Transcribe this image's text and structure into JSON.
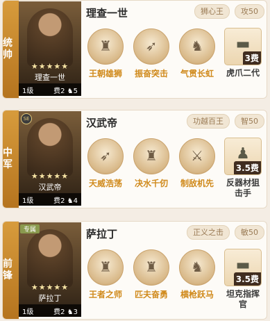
{
  "cards": [
    {
      "position": "统帅",
      "hero_name": "理查一世",
      "stars": "★★★★★",
      "level": "1级",
      "cost_label": "费2",
      "troop_count": "5",
      "tag1": "狮心王",
      "tag2": "攻50",
      "skills": [
        {
          "label": "王朝雄狮",
          "icon": "soldier-icon"
        },
        {
          "label": "振奋突击",
          "icon": "spear-icon"
        },
        {
          "label": "气贯长虹",
          "icon": "horse-icon"
        }
      ],
      "item": {
        "label": "虎爪二代",
        "cost": "3费",
        "icon": "tank-icon"
      }
    },
    {
      "position": "中军",
      "hero_name": "汉武帝",
      "stars": "★★★★★",
      "level": "1级",
      "cost_label": "费2",
      "troop_count": "4",
      "badge": "SE",
      "tag1": "功越百王",
      "tag2": "智50",
      "skills": [
        {
          "label": "天威浩荡",
          "icon": "spear-icon"
        },
        {
          "label": "决水千仞",
          "icon": "soldier-icon"
        },
        {
          "label": "制敌机先",
          "icon": "sword-icon"
        }
      ],
      "item": {
        "label": "反器材狙击手",
        "cost": "3.5费",
        "icon": "sniper-icon"
      }
    },
    {
      "position": "前锋",
      "hero_name": "萨拉丁",
      "stars": "★★★★★",
      "level": "1级",
      "cost_label": "费2",
      "troop_count": "3",
      "badge": "专属",
      "tag1": "正义之击",
      "tag2": "敏50",
      "skills": [
        {
          "label": "王者之师",
          "icon": "soldier-icon"
        },
        {
          "label": "匹夫奋勇",
          "icon": "soldier-icon"
        },
        {
          "label": "横枪跃马",
          "icon": "horse-icon"
        }
      ],
      "item": {
        "label": "坦克指挥官",
        "cost": "3.5费",
        "icon": "tank-icon"
      }
    }
  ]
}
